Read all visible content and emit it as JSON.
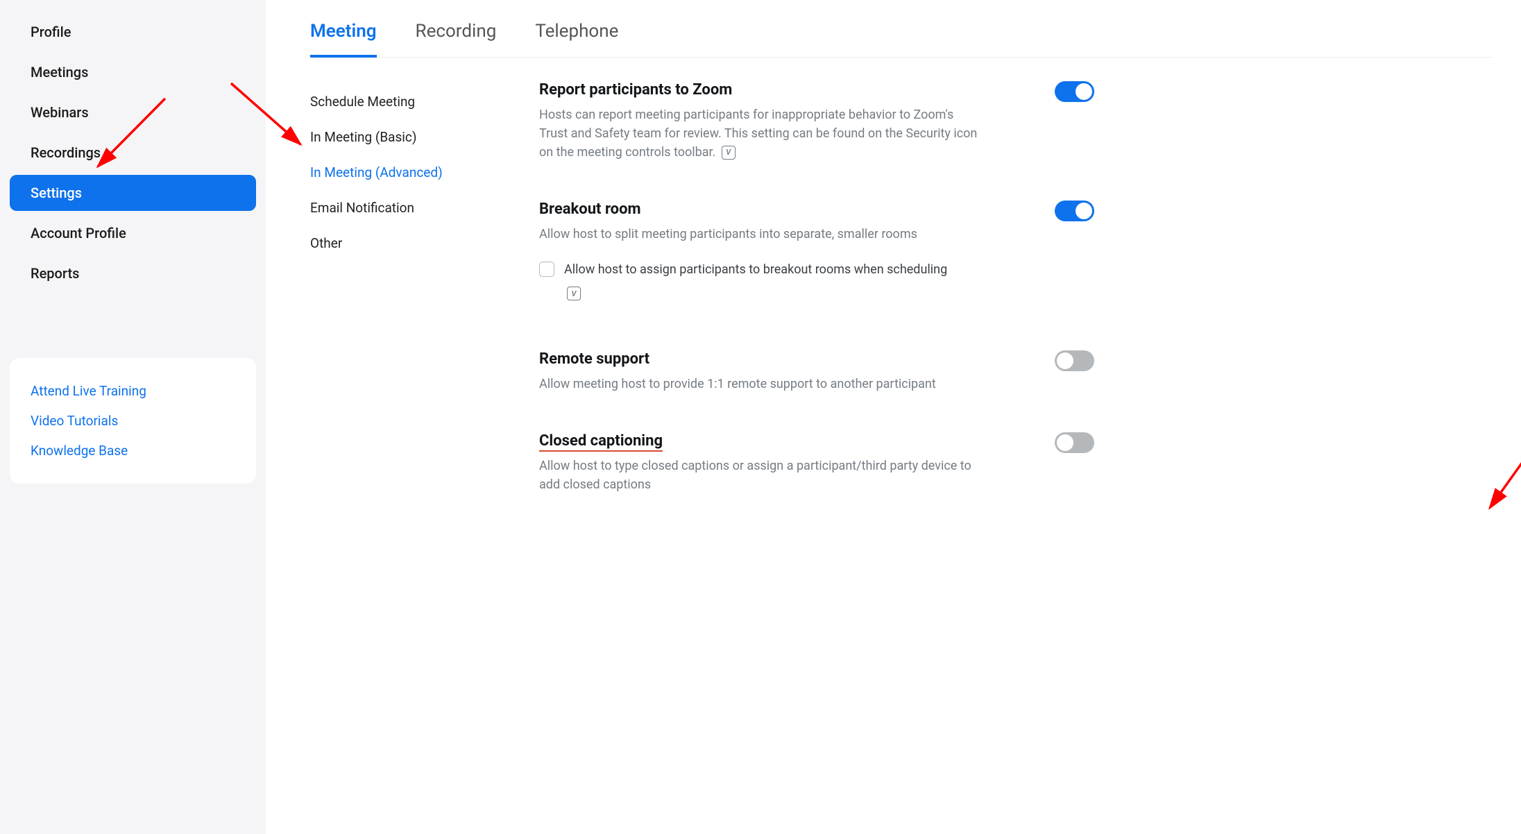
{
  "sidebar": {
    "items": [
      {
        "label": "Profile",
        "active": false
      },
      {
        "label": "Meetings",
        "active": false
      },
      {
        "label": "Webinars",
        "active": false
      },
      {
        "label": "Recordings",
        "active": false
      },
      {
        "label": "Settings",
        "active": true
      },
      {
        "label": "Account Profile",
        "active": false
      },
      {
        "label": "Reports",
        "active": false
      }
    ],
    "help_links": [
      "Attend Live Training",
      "Video Tutorials",
      "Knowledge Base"
    ]
  },
  "tabs": [
    {
      "label": "Meeting",
      "active": true
    },
    {
      "label": "Recording",
      "active": false
    },
    {
      "label": "Telephone",
      "active": false
    }
  ],
  "subnav": [
    {
      "label": "Schedule Meeting",
      "active": false
    },
    {
      "label": "In Meeting (Basic)",
      "active": false
    },
    {
      "label": "In Meeting (Advanced)",
      "active": true
    },
    {
      "label": "Email Notification",
      "active": false
    },
    {
      "label": "Other",
      "active": false
    }
  ],
  "settings": {
    "report": {
      "title": "Report participants to Zoom",
      "desc": "Hosts can report meeting participants for inappropriate behavior to Zoom's Trust and Safety team for review. This setting can be found on the Security icon on the meeting controls toolbar.",
      "toggle": true
    },
    "breakout": {
      "title": "Breakout room",
      "desc": "Allow host to split meeting participants into separate, smaller rooms",
      "toggle": true,
      "sub_option": "Allow host to assign participants to breakout rooms when scheduling",
      "sub_checked": false
    },
    "remote_support": {
      "title": "Remote support",
      "desc": "Allow meeting host to provide 1:1 remote support to another participant",
      "toggle": false
    },
    "closed_caption": {
      "title": "Closed captioning",
      "desc": "Allow host to type closed captions or assign a participant/third party device to add closed captions",
      "toggle": false
    }
  },
  "colors": {
    "accent": "#0e72ec",
    "arrow": "#ff0000"
  }
}
